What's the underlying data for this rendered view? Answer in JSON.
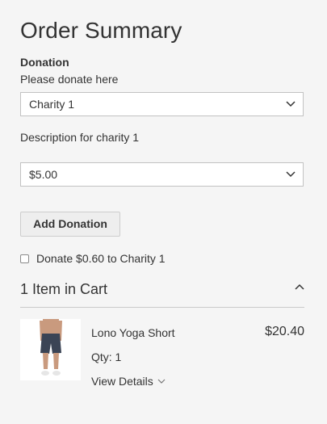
{
  "summary": {
    "title": "Order Summary",
    "donation_label": "Donation",
    "donation_prompt": "Please donate here",
    "charity_select": {
      "value": "Charity 1"
    },
    "description": "Description for charity 1",
    "amount_select": {
      "value": "$5.00"
    },
    "add_button": "Add Donation",
    "roundup_label": "Donate $0.60 to Charity 1"
  },
  "cart": {
    "title": "1 Item in Cart",
    "items": [
      {
        "name": "Lono Yoga Short",
        "price": "$20.40",
        "qty": "Qty: 1",
        "details": "View Details"
      }
    ]
  },
  "icons": {
    "select_chevron": "chevron-down-icon",
    "cart_toggle": "chevron-up-icon",
    "details_chevron": "chevron-down-icon"
  }
}
